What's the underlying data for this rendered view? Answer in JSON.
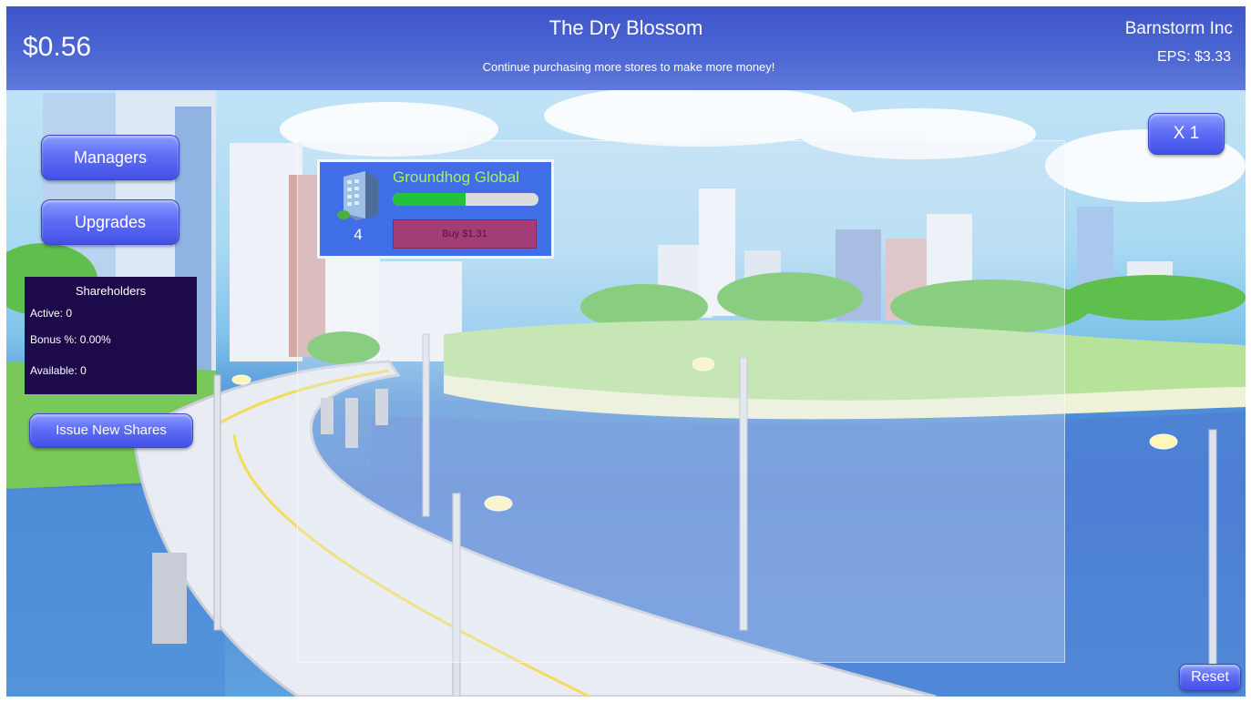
{
  "header": {
    "money": "$0.56",
    "store_title": "The Dry Blossom",
    "hint": "Continue purchasing more stores to make more money!",
    "company": "Barnstorm Inc",
    "eps": "EPS: $3.33"
  },
  "menu": {
    "managers_label": "Managers",
    "upgrades_label": "Upgrades",
    "issue_shares_label": "Issue New Shares"
  },
  "shareholders": {
    "title": "Shareholders",
    "active": "Active: 0",
    "bonus": "Bonus %: 0.00%",
    "available": "Available: 0"
  },
  "multiplier_label": "X 1",
  "reset_label": "Reset",
  "stores": [
    {
      "name": "Groundhog Global",
      "count": "4",
      "buy_label": "Buy $1.31",
      "progress": 0.5,
      "icon": "office-building-icon"
    }
  ],
  "colors": {
    "topbar": "#4d67d4",
    "button": "#5f6ef5",
    "card": "#3f6ee6",
    "buy_button": "#a33d78",
    "progress_fill": "#23c13c",
    "store_name": "#a8f05a",
    "shareholder_panel": "#1c0a4a"
  }
}
